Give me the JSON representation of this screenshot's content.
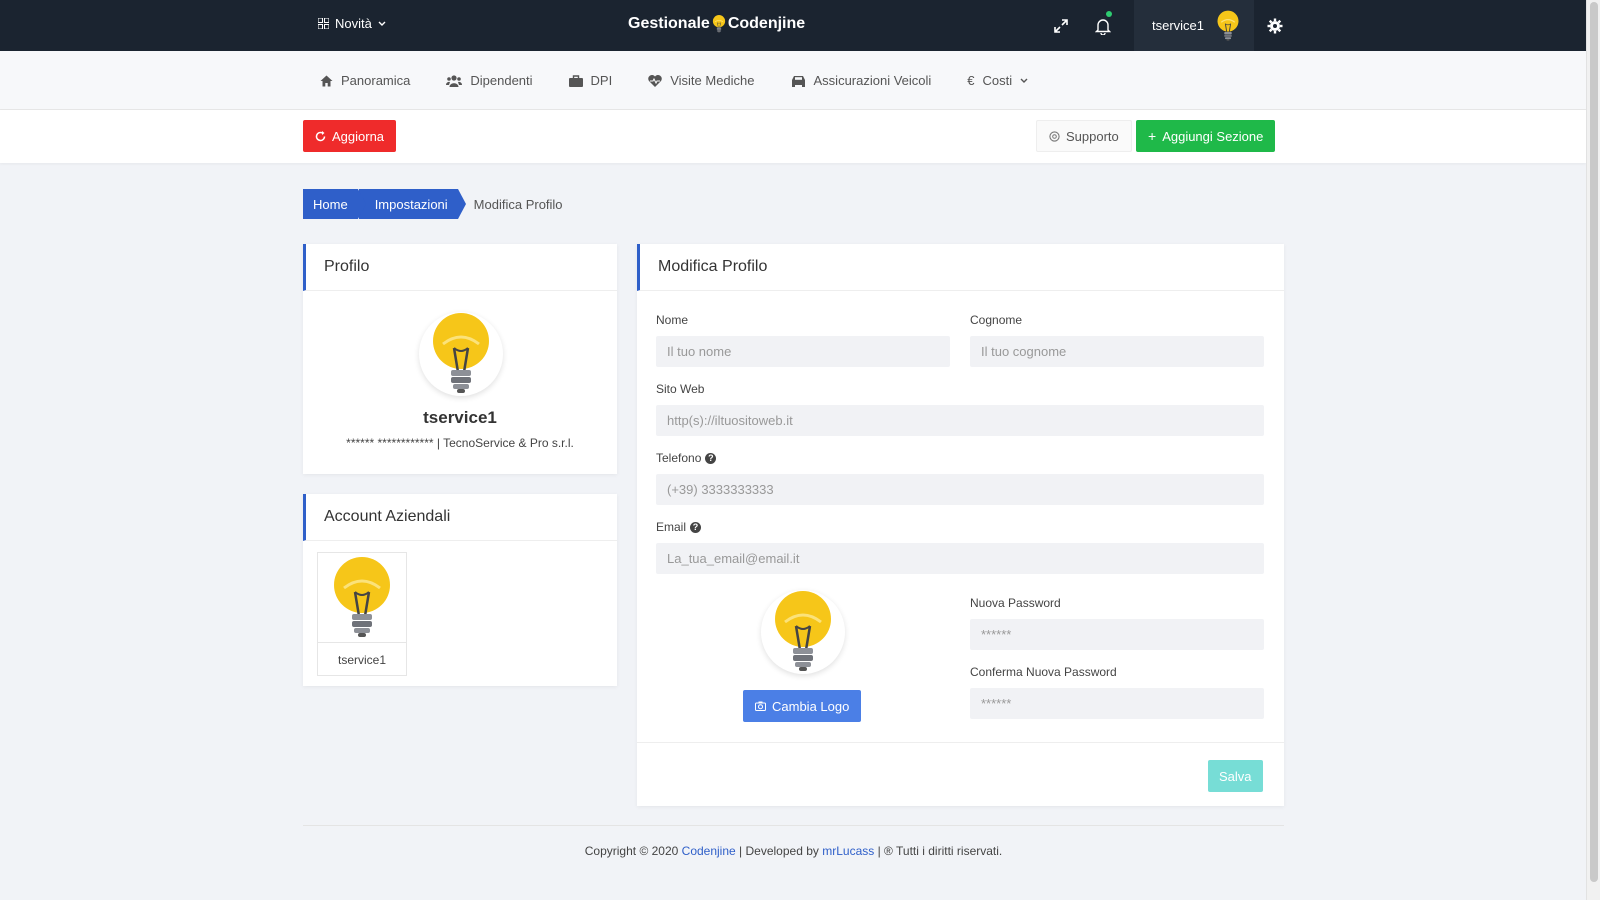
{
  "topbar": {
    "novita_label": "Novità",
    "brand_part1": "Gestionale",
    "brand_part2": "Codenjine",
    "username": "tservice1"
  },
  "nav": {
    "items": [
      {
        "label": "Panoramica",
        "icon": "home-icon"
      },
      {
        "label": "Dipendenti",
        "icon": "users-icon"
      },
      {
        "label": "DPI",
        "icon": "briefcase-icon"
      },
      {
        "label": "Visite Mediche",
        "icon": "heartbeat-icon"
      },
      {
        "label": "Assicurazioni Veicoli",
        "icon": "car-icon"
      },
      {
        "label": "Costi",
        "icon": "euro-icon"
      }
    ]
  },
  "actions": {
    "refresh_label": "Aggiorna",
    "support_label": "Supporto",
    "add_section_label": "Aggiungi Sezione"
  },
  "breadcrumb": {
    "home": "Home",
    "settings": "Impostazioni",
    "current": "Modifica Profilo"
  },
  "profile": {
    "title": "Profilo",
    "name": "tservice1",
    "subtitle": "****** ************ | TecnoService & Pro s.r.l."
  },
  "accounts": {
    "title": "Account Aziendali",
    "items": [
      {
        "label": "tservice1"
      }
    ]
  },
  "edit": {
    "title": "Modifica Profilo",
    "nome_label": "Nome",
    "nome_placeholder": "Il tuo nome",
    "cognome_label": "Cognome",
    "cognome_placeholder": "Il tuo cognome",
    "sito_label": "Sito Web",
    "sito_placeholder": "http(s)://iltuositoweb.it",
    "telefono_label": "Telefono",
    "telefono_placeholder": "(+39) 3333333333",
    "email_label": "Email",
    "email_placeholder": "La_tua_email@email.it",
    "new_password_label": "Nuova Password",
    "new_password_placeholder": "******",
    "confirm_password_label": "Conferma Nuova Password",
    "confirm_password_placeholder": "******",
    "change_logo_label": "Cambia Logo",
    "save_label": "Salva",
    "help_symbol": "?"
  },
  "footer": {
    "copyright": "Copyright © 2020",
    "brand_link": "Codenjine",
    "developed_by": "| Developed by",
    "dev_link": "mrLucass",
    "rights": "| ® Tutti i diritti riservati."
  },
  "colors": {
    "topbar": "#1b2430",
    "primary": "#2f5fc9",
    "danger": "#ef2b2b",
    "success": "#1fb949",
    "bulb": "#f5c518"
  }
}
